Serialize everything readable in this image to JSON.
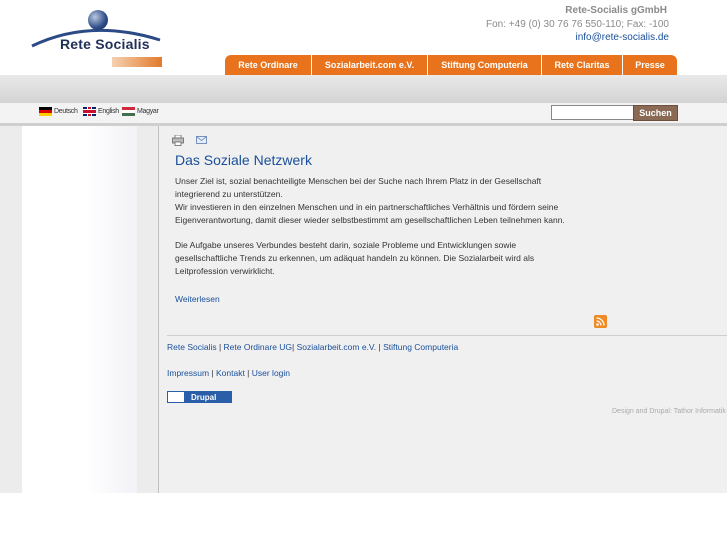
{
  "header": {
    "logo_text": "Rete Socialis",
    "company": "Rete-Socialis gGmbH",
    "phone": "Fon: +49 (0) 30 76 76 550-110; Fax: -100",
    "email": "info@rete-socialis.de"
  },
  "nav": {
    "tabs": [
      {
        "label": "Rete Ordinare"
      },
      {
        "label": "Sozialarbeit.com e.V."
      },
      {
        "label": "Stiftung Computeria"
      },
      {
        "label": "Rete Claritas"
      },
      {
        "label": "Presse"
      }
    ]
  },
  "languages": [
    {
      "label": "Deutsch",
      "icon": "german-flag-icon"
    },
    {
      "label": "English",
      "icon": "uk-flag-icon"
    },
    {
      "label": "Magyar",
      "icon": "hungarian-flag-icon"
    }
  ],
  "search": {
    "value": "",
    "button_label": "Suchen"
  },
  "content": {
    "title": "Das Soziale Netzwerk",
    "para1_line1": "Unser Ziel ist, sozial benachteiligte Menschen bei der Suche nach Ihrem Platz in der Gesellschaft",
    "para1_line2": "integrierend zu unterstützen.",
    "para1_line3": "Wir investieren in den einzelnen Menschen und in ein partnerschaftliches Verhältnis und fördern seine",
    "para1_line4": "Eigenverantwortung, damit dieser wieder selbstbestimmt am gesellschaftlichen Leben teilnehmen kann.",
    "para2_line1": "Die Aufgabe unseres Verbundes besteht darin, soziale Probleme und Entwicklungen sowie",
    "para2_line2": "gesellschaftliche Trends zu erkennen, um adäquat handeln zu können. Die Sozialarbeit wird als",
    "para2_line3": "Leitprofession verwirklicht.",
    "read_more": "Weiterlesen"
  },
  "footer": {
    "links1": [
      "Rete Socialis",
      "Rete Ordinare UG",
      "Sozialarbeit.com e.V.",
      "Stiftung Computeria"
    ],
    "links2": [
      "Impressum",
      "Kontakt",
      "User login"
    ],
    "drupal_label": "Drupal",
    "credits": "Design and Drupal: Tathor Informatik"
  }
}
